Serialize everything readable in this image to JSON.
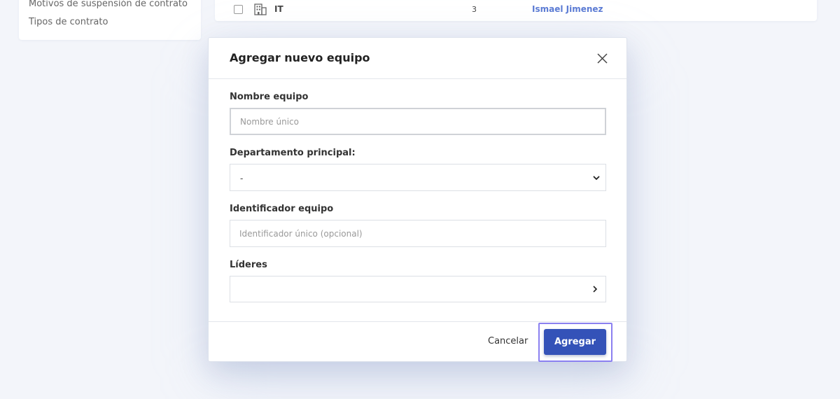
{
  "sidebar": {
    "items": [
      {
        "label": "Motivos de suspensión de contrato"
      },
      {
        "label": "Tipos de contrato"
      }
    ]
  },
  "table": {
    "row": {
      "icon": "building-icon",
      "name": "IT",
      "count": "3",
      "leader": "Ismael Jimenez"
    }
  },
  "modal": {
    "title": "Agregar nuevo equipo",
    "close_icon": "close-icon",
    "fields": {
      "team_name": {
        "label": "Nombre equipo",
        "placeholder": "Nombre único",
        "value": ""
      },
      "department": {
        "label": "Departamento principal:",
        "value": "-"
      },
      "team_id": {
        "label": "Identificador equipo",
        "placeholder": "Identificador único (opcional)",
        "value": ""
      },
      "leaders": {
        "label": "Líderes",
        "value": ""
      }
    },
    "buttons": {
      "cancel": "Cancelar",
      "submit": "Agregar"
    }
  },
  "colors": {
    "primary": "#3452b8",
    "focus_outline": "#8b80f0",
    "link": "#5b7bd4",
    "background": "#f3f5fa"
  }
}
